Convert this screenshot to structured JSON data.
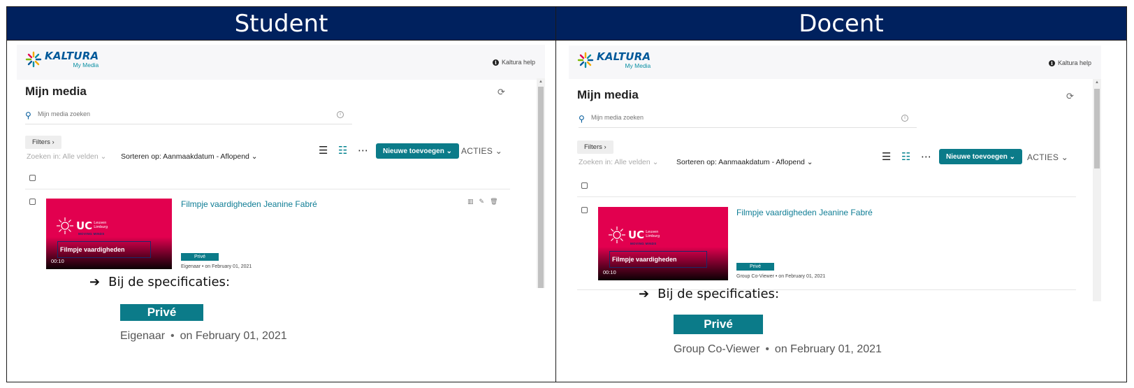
{
  "panels": {
    "student": {
      "header": "Student",
      "app": {
        "brand": "KALTURA",
        "brand_sub": "My Media",
        "help_label": "Kaltura help",
        "page_title": "Mijn media",
        "search_placeholder": "Mijn media zoeken",
        "filters_label": "Filters",
        "zoeken_label": "Zoeken in: Alle velden",
        "sorteren_label": "Sorteren op: Aanmaakdatum - Aflopend",
        "nieuwe_label": "Nieuwe toevoegen",
        "acties_label": "ACTIES",
        "entry": {
          "title": "Filmpje vaardigheden Jeanine Fabré",
          "thumb_uc": "UC",
          "thumb_uc_sub1": "Leuven",
          "thumb_uc_sub2": "Limburg",
          "thumb_moving": "MOVING MINDS",
          "thumb_title": "Filmpje vaardigheden",
          "duration": "00:10",
          "badge": "Privé",
          "role": "Eigenaar",
          "date": "on February 01, 2021"
        }
      },
      "spec": {
        "label": "Bij de specificaties:",
        "badge": "Privé",
        "role": "Eigenaar",
        "date": "on February 01, 2021"
      }
    },
    "docent": {
      "header": "Docent",
      "app": {
        "brand": "KALTURA",
        "brand_sub": "My Media",
        "help_label": "Kaltura help",
        "page_title": "Mijn media",
        "search_placeholder": "Mijn media zoeken",
        "filters_label": "Filters",
        "zoeken_label": "Zoeken in: Alle velden",
        "sorteren_label": "Sorteren op: Aanmaakdatum - Aflopend",
        "nieuwe_label": "Nieuwe toevoegen",
        "acties_label": "ACTIES",
        "entry": {
          "title": "Filmpje vaardigheden Jeanine Fabré",
          "thumb_uc": "UC",
          "thumb_uc_sub1": "Leuven",
          "thumb_uc_sub2": "Limburg",
          "thumb_moving": "MOVING MINDS",
          "thumb_title": "Filmpje vaardigheden",
          "duration": "00:10",
          "badge": "Privé",
          "role": "Group Co-Viewer",
          "date": "on February 01, 2021"
        }
      },
      "spec": {
        "label": "Bij de specificaties:",
        "badge": "Privé",
        "role": "Group Co-Viewer",
        "date": "on February 01, 2021"
      }
    }
  },
  "colors": {
    "header_bg": "#00215e",
    "accent_teal": "#0b7b89",
    "link_blue": "#0f7d95",
    "thumb_pink": "#e2004f"
  },
  "icons": [
    "kaltura-logo-icon",
    "info-icon",
    "refresh-icon",
    "search-icon",
    "list-view-icon",
    "detailed-view-icon",
    "grid-view-icon",
    "chevron-down-icon",
    "analytics-icon",
    "edit-icon",
    "delete-icon",
    "arrow-right-icon"
  ]
}
